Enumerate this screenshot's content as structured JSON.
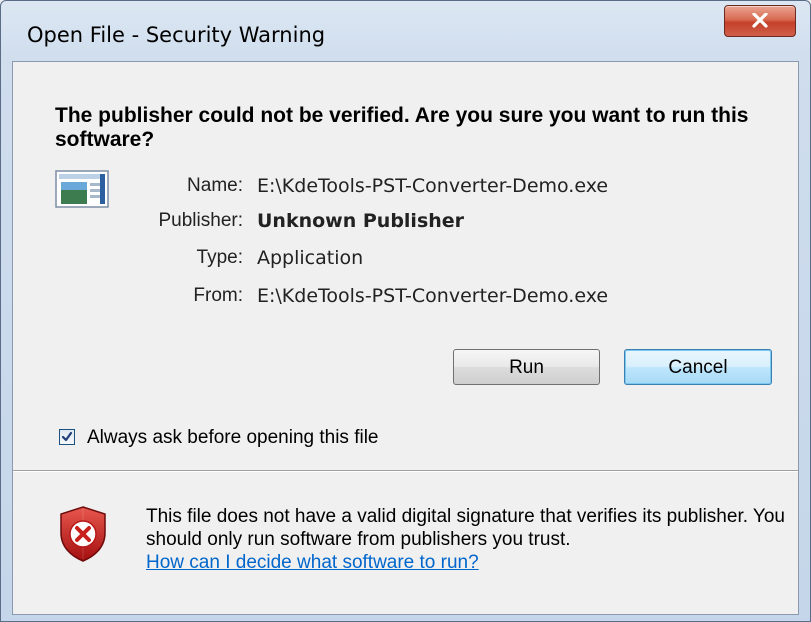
{
  "window": {
    "title": "Open File - Security Warning",
    "close_icon": "close-icon"
  },
  "prompt": {
    "heading": "The publisher could not be verified.  Are you sure you want to run this software?"
  },
  "file_info": {
    "icon": "application-icon",
    "fields": [
      {
        "label": "Name:",
        "value": "E:\\KdeTools-PST-Converter-Demo.exe",
        "bold": false
      },
      {
        "label": "Publisher:",
        "value": "Unknown Publisher",
        "bold": true
      },
      {
        "label": "Type:",
        "value": "Application",
        "bold": false
      },
      {
        "label": "From:",
        "value": "E:\\KdeTools-PST-Converter-Demo.exe",
        "bold": false
      }
    ]
  },
  "buttons": {
    "run": "Run",
    "cancel": "Cancel"
  },
  "option": {
    "checked": true,
    "label": "Always ask before opening this file"
  },
  "warning": {
    "icon": "security-shield-icon",
    "text": "This file does not have a valid digital signature that verifies its publisher.  You should only run software from publishers you trust.",
    "link": "How can I decide what software to run?"
  },
  "colors": {
    "link": "#0066cc",
    "shield_red": "#c8201c",
    "cancel_border": "#3c7fb1"
  }
}
